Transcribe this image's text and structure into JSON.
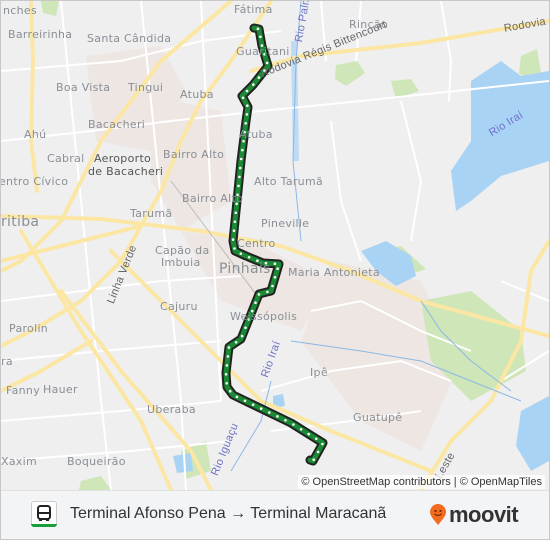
{
  "map": {
    "neighborhood_labels": [
      {
        "id": "fatima",
        "text": "Fátima"
      },
      {
        "id": "rincao",
        "text": "Rincão"
      },
      {
        "id": "barreirinha",
        "text": "Barreirinha"
      },
      {
        "id": "santa-candida",
        "text": "Santa Cândida"
      },
      {
        "id": "guaritani",
        "text": "Guaritani"
      },
      {
        "id": "boa-vista",
        "text": "Boa Vista"
      },
      {
        "id": "tingui",
        "text": "Tingui"
      },
      {
        "id": "atuba-1",
        "text": "Atuba"
      },
      {
        "id": "ahu",
        "text": "Ahú"
      },
      {
        "id": "bacacheri",
        "text": "Bacacheri"
      },
      {
        "id": "atuba-2",
        "text": "Atuba"
      },
      {
        "id": "cabral",
        "text": "Cabral"
      },
      {
        "id": "bairro-alto-1",
        "text": "Bairro Alto"
      },
      {
        "id": "centro-civico",
        "text": "Centro Cívico"
      },
      {
        "id": "alto-taruma",
        "text": "Alto Tarumã"
      },
      {
        "id": "bairro-alto-2",
        "text": "Bairro Alto"
      },
      {
        "id": "taruma",
        "text": "Tarumã"
      },
      {
        "id": "pineville",
        "text": "Pineville"
      },
      {
        "id": "centro",
        "text": "Centro"
      },
      {
        "id": "capao-da-imbuia-1",
        "text": "Capão da"
      },
      {
        "id": "capao-da-imbuia-2",
        "text": "Imbuia"
      },
      {
        "id": "maria-antonieta",
        "text": "Maria Antonieta"
      },
      {
        "id": "cajuru",
        "text": "Cajuru"
      },
      {
        "id": "weissopolis",
        "text": "Weissópolis"
      },
      {
        "id": "parolin",
        "text": "Parolin"
      },
      {
        "id": "ipe",
        "text": "Ipê"
      },
      {
        "id": "fanny",
        "text": "Fanny"
      },
      {
        "id": "hauer",
        "text": "Hauer"
      },
      {
        "id": "uberaba",
        "text": "Uberaba"
      },
      {
        "id": "guatupe",
        "text": "Guatupê"
      },
      {
        "id": "xaxim",
        "text": "Xaxim"
      },
      {
        "id": "boqueirao",
        "text": "Boqueirão"
      },
      {
        "id": "vila-pinches",
        "text": "nches"
      },
      {
        "id": "gua-partial",
        "text": "ra"
      }
    ],
    "city_labels": [
      {
        "id": "curitiba",
        "text": "ritiba"
      },
      {
        "id": "pinhais",
        "text": "Pinhais"
      }
    ],
    "poi_labels": [
      {
        "id": "airport-1",
        "text": "Aeroporto"
      },
      {
        "id": "airport-2",
        "text": "de Bacacheri"
      }
    ],
    "road_labels": [
      {
        "id": "rodovia-regis",
        "text": "Rodovia Régis Bittencourt"
      },
      {
        "id": "rodovia-r",
        "text": "Rodovia R"
      },
      {
        "id": "linha-verde",
        "text": "Linha Verde"
      },
      {
        "id": "leste",
        "text": "Leste"
      }
    ],
    "water_labels": [
      {
        "id": "rio-palmital",
        "text": "Rio Palm"
      },
      {
        "id": "rio-irai-1",
        "text": "Rio Iraí"
      },
      {
        "id": "rio-irai-2",
        "text": "Rio Iraí"
      },
      {
        "id": "rio-iguacu",
        "text": "Rio Iguaçu"
      }
    ],
    "route_color": "#1a8a35",
    "attribution": "© OpenStreetMap contributors | © OpenMapTiles"
  },
  "footer": {
    "transit_mode_icon": "bus-icon",
    "route_title": "Terminal Afonso Pena → Terminal Maracanã",
    "brand": "moovit",
    "brand_icon": "moovit-pin-icon",
    "brand_accent": "#f26b21"
  }
}
